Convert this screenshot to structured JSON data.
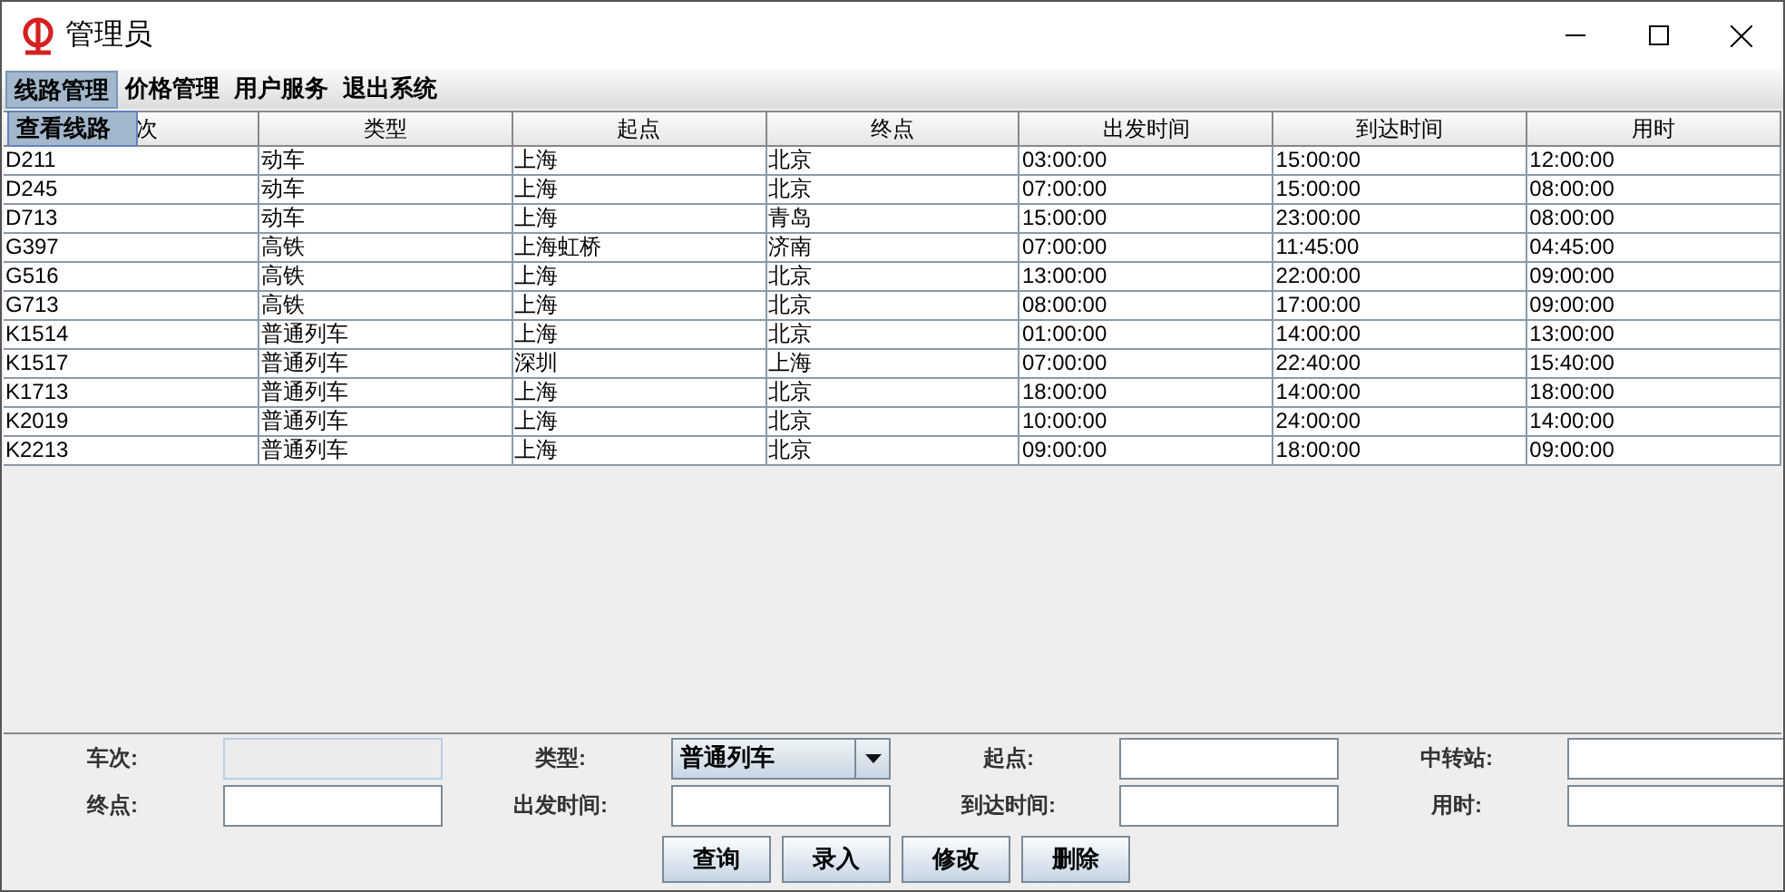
{
  "window": {
    "title": "管理员"
  },
  "menu": [
    {
      "label": "线路管理",
      "selected": true
    },
    {
      "label": "价格管理",
      "selected": false
    },
    {
      "label": "用户服务",
      "selected": false
    },
    {
      "label": "退出系统",
      "selected": false
    }
  ],
  "popup": {
    "items": [
      "查看线路"
    ]
  },
  "table": {
    "columns": [
      "次",
      "类型",
      "起点",
      "终点",
      "出发时间",
      "到达时间",
      "用时"
    ],
    "rows": [
      [
        "D211",
        "动车",
        "上海",
        "北京",
        "03:00:00",
        "15:00:00",
        "12:00:00"
      ],
      [
        "D245",
        "动车",
        "上海",
        "北京",
        "07:00:00",
        "15:00:00",
        "08:00:00"
      ],
      [
        "D713",
        "动车",
        "上海",
        "青岛",
        "15:00:00",
        "23:00:00",
        "08:00:00"
      ],
      [
        "G397",
        "高铁",
        "上海虹桥",
        "济南",
        "07:00:00",
        "11:45:00",
        "04:45:00"
      ],
      [
        "G516",
        "高铁",
        "上海",
        "北京",
        "13:00:00",
        "22:00:00",
        "09:00:00"
      ],
      [
        "G713",
        "高铁",
        "上海",
        "北京",
        "08:00:00",
        "17:00:00",
        "09:00:00"
      ],
      [
        "K1514",
        "普通列车",
        "上海",
        "北京",
        "01:00:00",
        "14:00:00",
        "13:00:00"
      ],
      [
        "K1517",
        "普通列车",
        "深圳",
        "上海",
        "07:00:00",
        "22:40:00",
        "15:40:00"
      ],
      [
        "K1713",
        "普通列车",
        "上海",
        "北京",
        "18:00:00",
        "14:00:00",
        "18:00:00"
      ],
      [
        "K2019",
        "普通列车",
        "上海",
        "北京",
        "10:00:00",
        "24:00:00",
        "14:00:00"
      ],
      [
        "K2213",
        "普通列车",
        "上海",
        "北京",
        "09:00:00",
        "18:00:00",
        "09:00:00"
      ]
    ]
  },
  "form": [
    {
      "label": "车次:",
      "kind": "text",
      "disabled": true
    },
    {
      "label": "类型:",
      "kind": "combo",
      "value": "普通列车",
      "disabled": false
    },
    {
      "label": "起点:",
      "kind": "text",
      "disabled": false
    },
    {
      "label": "中转站:",
      "kind": "text",
      "disabled": false
    },
    {
      "label": "终点:",
      "kind": "text",
      "disabled": false
    },
    {
      "label": "出发时间:",
      "kind": "text",
      "disabled": false
    },
    {
      "label": "到达时间:",
      "kind": "text",
      "disabled": false
    },
    {
      "label": "用时:",
      "kind": "text",
      "disabled": false
    }
  ],
  "buttons": [
    "查询",
    "录入",
    "修改",
    "删除"
  ]
}
